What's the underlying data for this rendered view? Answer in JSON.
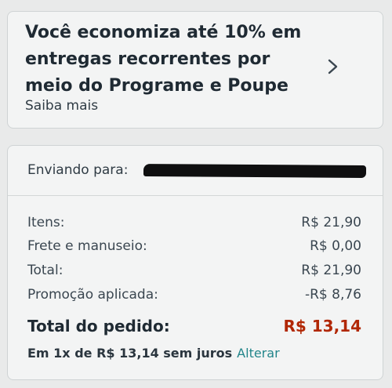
{
  "promo": {
    "title": "Você economiza até 10% em entregas recorrentes por meio do Programe e Poupe",
    "link_label": "Saiba mais",
    "chevron_icon": "chevron-right-icon"
  },
  "shipping": {
    "label": "Enviando para:"
  },
  "summary": {
    "items_label": "Itens:",
    "items_value": "R$ 21,90",
    "shipping_label": "Frete e manuseio:",
    "shipping_value": "R$ 0,00",
    "total_label": "Total:",
    "total_value": "R$ 21,90",
    "promo_label": "Promoção aplicada:",
    "promo_value": "-R$ 8,76",
    "order_total_label": "Total do pedido:",
    "order_total_value": "R$ 13,14",
    "order_total_color": "#b12704"
  },
  "installments": {
    "text": "Em 1x de R$ 13,14 sem juros",
    "change_label": "Alterar",
    "change_color": "#22858a"
  }
}
